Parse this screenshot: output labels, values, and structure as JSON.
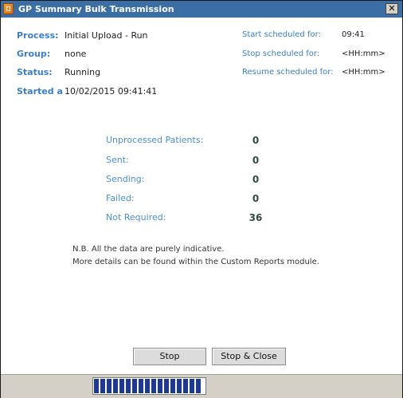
{
  "window": {
    "title": "GP Summary Bulk Transmission",
    "close_glyph": "✕"
  },
  "info_left": {
    "process_label": "Process:",
    "process_value": "Initial Upload - Run",
    "group_label": "Group:",
    "group_value": "none",
    "status_label": "Status:",
    "status_value": "Running",
    "started_label": "Started a",
    "started_value": "10/02/2015 09:41:41"
  },
  "info_right": {
    "start_label": "Start scheduled for:",
    "start_value": "09:41",
    "stop_label": "Stop scheduled for:",
    "stop_value": "<HH:mm>",
    "resume_label": "Resume scheduled for:",
    "resume_value": "<HH:mm>"
  },
  "stats": [
    {
      "label": "Unprocessed Patients:",
      "value": "0"
    },
    {
      "label": "Sent:",
      "value": "0"
    },
    {
      "label": "Sending:",
      "value": "0"
    },
    {
      "label": "Failed:",
      "value": "0"
    },
    {
      "label": "Not Required:",
      "value": "36"
    }
  ],
  "note": {
    "line1": "N.B. All the data are purely indicative.",
    "line2": "More details can be found within the Custom Reports module."
  },
  "buttons": {
    "stop_label": "Stop",
    "stop_close_label": "Stop & Close"
  },
  "progress": {
    "fraction": 0.98
  },
  "colors": {
    "titlebar": "#3a6ea5",
    "label_blue": "#3a7fc4",
    "progress": "#1c3b8e"
  }
}
